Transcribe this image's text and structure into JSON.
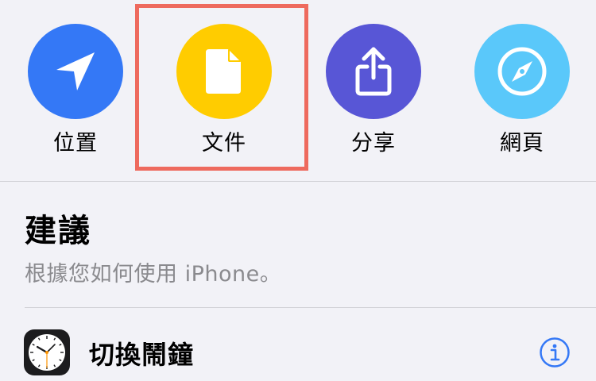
{
  "categories": [
    {
      "label": "位置",
      "icon": "location-arrow-icon",
      "color": "#3478f6"
    },
    {
      "label": "文件",
      "icon": "document-icon",
      "color": "#ffcc00"
    },
    {
      "label": "分享",
      "icon": "share-icon",
      "color": "#5856d6"
    },
    {
      "label": "網頁",
      "icon": "compass-icon",
      "color": "#5ac8fa"
    }
  ],
  "selected_category": "文件",
  "highlight_color": "#ee6a5e",
  "suggestions": {
    "title": "建議",
    "subtitle": "根據您如何使用 iPhone。",
    "items": [
      {
        "title": "切換鬧鐘",
        "icon": "clock-icon",
        "accessory": "info-icon"
      }
    ]
  },
  "colors": {
    "accent": "#3478f6",
    "background": "#f2f2f7",
    "secondary_text": "#8a8a8e"
  }
}
